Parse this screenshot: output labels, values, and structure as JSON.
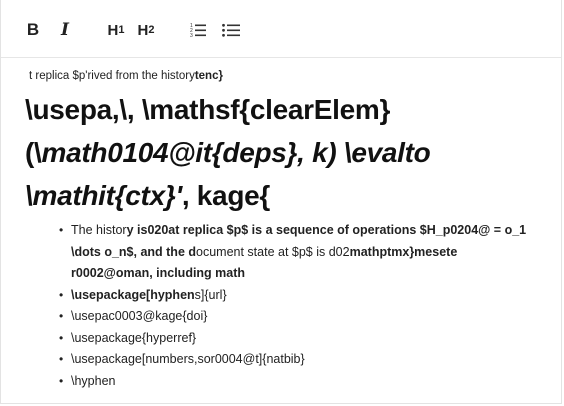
{
  "toolbar": {
    "bold_label": "B",
    "italic_label": "I",
    "h1_label": "H",
    "h1_sub": "1",
    "h2_label": "H",
    "h2_sub": "2",
    "icons": [
      "ordered-list-icon",
      "unordered-list-icon"
    ]
  },
  "paragraph": {
    "text_plain": "t replica $p'rived from the history",
    "text_bold": "tenc}"
  },
  "heading": {
    "line1": "\\usepa,\\, \\mathsf{clearElem}",
    "line2_a": "(\\",
    "line2_it": "math0104@it{deps}, k) \\evalto",
    "line3_it": "\\mathit{ctx}'",
    "line3_b": ", kage{"
  },
  "list": [
    {
      "segments": [
        {
          "t": "The histor",
          "b": false
        },
        {
          "t": "y is020at replica $p$ is a sequence of operations $H_p0204@ = o_1 \\dots o_n$, and the d",
          "b": true
        },
        {
          "t": "ocument state at $p$ is d02",
          "b": false
        },
        {
          "t": "mathptmx}mesete r0002@oman, including math",
          "b": true
        }
      ]
    },
    {
      "segments": [
        {
          "t": "\\usepackage[hyphen",
          "b": true
        },
        {
          "t": "s]{url}",
          "b": false
        }
      ]
    },
    {
      "segments": [
        {
          "t": "\\usepac0003@kage{doi}",
          "b": false
        }
      ]
    },
    {
      "segments": [
        {
          "t": "\\usepackage{hyperref}",
          "b": false
        }
      ]
    },
    {
      "segments": [
        {
          "t": "\\usepackage[numbers,sor0004@t]{natbib}",
          "b": false
        }
      ]
    },
    {
      "segments": [
        {
          "t": "\\hyphen",
          "b": false
        }
      ]
    }
  ]
}
